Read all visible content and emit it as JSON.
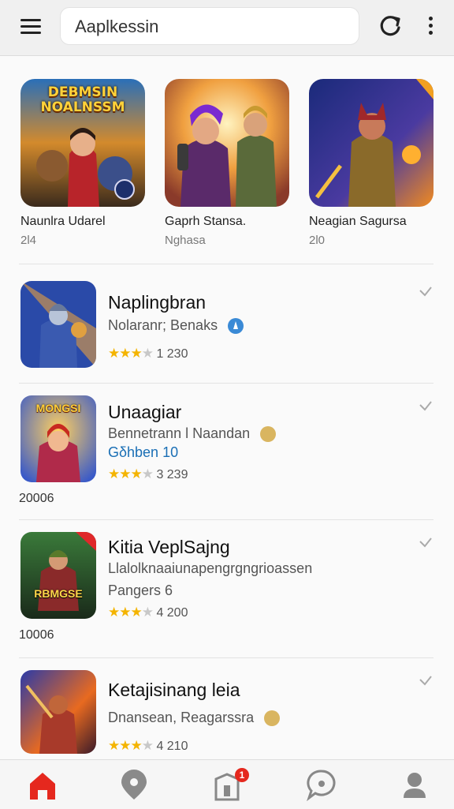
{
  "header": {
    "search_value": "Aaplkessin",
    "menu_icon": "hamburger-menu-icon",
    "refresh_icon": "refresh-icon",
    "more_icon": "more-vertical-icon"
  },
  "featured": [
    {
      "name": "Naunlra Udarel",
      "sub": "2l4",
      "banner": "DEBMSIN NOALNSSM"
    },
    {
      "name": "Gaprh Stansa.",
      "sub": "Nghasa"
    },
    {
      "name": "Neagian Sagursa",
      "sub": "2l0"
    }
  ],
  "list": [
    {
      "title": "Naplingbran",
      "subtitle": "Nolaranr; Benaks",
      "extra": "",
      "rating": "1 230",
      "stars": 3,
      "count": ""
    },
    {
      "title": "Unaagiar",
      "subtitle": "Bennetrann l Naandan",
      "extra": "Gδhben 10",
      "rating": "3 239",
      "stars": 3,
      "count": "20006",
      "banner": "MONGSI"
    },
    {
      "title": "Kitia VeplSajng",
      "subtitle": "Llalolknaaiunapengrgngrioassen",
      "extra": "Pangers 6",
      "rating": "4 200",
      "stars": 3,
      "count": "10006",
      "banner": "RBMGSE"
    },
    {
      "title": "Ketajisinang leia",
      "subtitle": "Dnansean, Reagarssra",
      "extra": "",
      "rating": "4 210",
      "stars": 3,
      "count": ""
    }
  ],
  "nav": {
    "home_icon": "home-icon",
    "explore_icon": "location-pin-icon",
    "store_icon": "store-bag-icon",
    "notification_badge": "1",
    "chat_icon": "chat-bubble-icon",
    "profile_icon": "profile-icon"
  },
  "colors": {
    "accent": "#e5281e",
    "star": "#f4b400"
  }
}
